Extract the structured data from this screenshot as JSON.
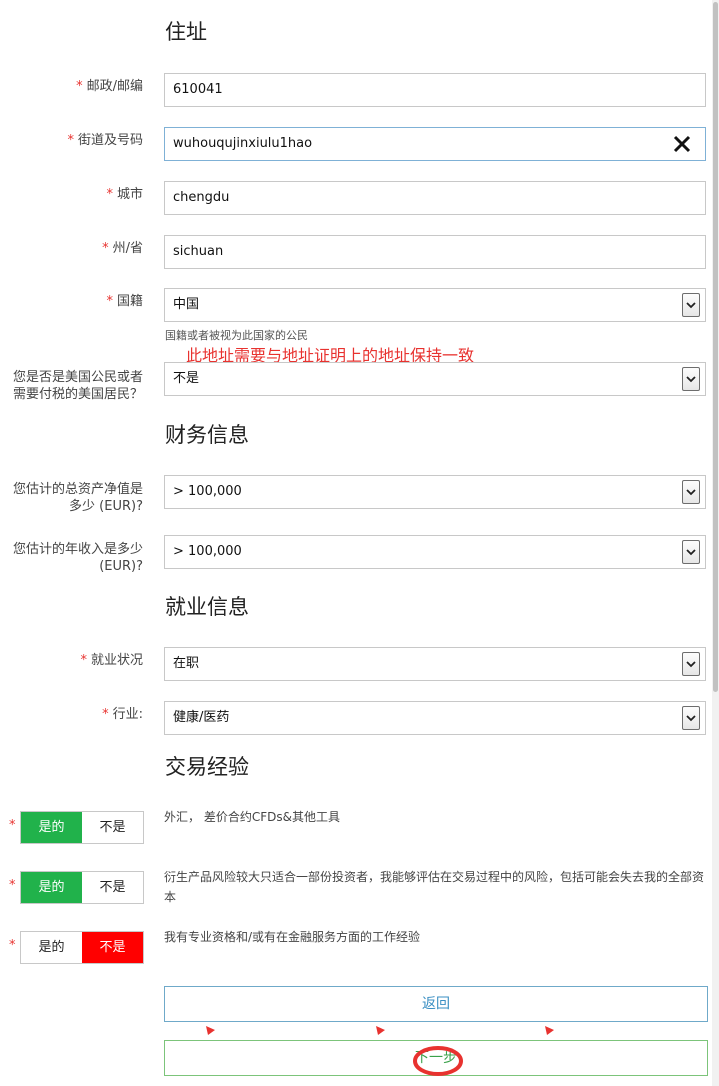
{
  "address": {
    "title": "住址",
    "postal": {
      "label": "邮政/邮编",
      "value": "610041"
    },
    "street": {
      "label": "街道及号码",
      "value": "wuhouqujinxiulu1hao"
    },
    "city": {
      "label": "城市",
      "value": "chengdu"
    },
    "state": {
      "label": "州/省",
      "value": "sichuan"
    },
    "nationality": {
      "label": "国籍",
      "value": "中国",
      "hint": "国籍或者被视为此国家的公民"
    },
    "annotation": "此地址需要与地址证明上的地址保持一致",
    "us_citizen": {
      "label_line1": "您是否是美国公民或者",
      "label_line2": "需要付税的美国居民？",
      "value": "不是"
    }
  },
  "finance": {
    "title": "财务信息",
    "net_worth": {
      "label_line1": "您估计的总资产净值是",
      "label_line2": "多少 (EUR)?",
      "value": "> 100,000"
    },
    "income": {
      "label_line1": "您估计的年收入是多少",
      "label_line2": "(EUR)?",
      "value": "> 100,000"
    }
  },
  "employment": {
    "title": "就业信息",
    "status": {
      "label": "就业状况",
      "value": "在职"
    },
    "industry": {
      "label": "行业:",
      "value": "健康/医药"
    }
  },
  "experience": {
    "title": "交易经验",
    "yes_label": "是的",
    "no_label": "不是",
    "q1": {
      "text": "外汇， 差价合约CFDs&其他工具",
      "selected": "yes"
    },
    "q2": {
      "text": "衍生产品风险较大只适合一部份投资者，我能够评估在交易过程中的风险，包括可能会失去我的全部资本",
      "selected": "yes"
    },
    "q3": {
      "text": "我有专业资格和/或有在金融服务方面的工作经验",
      "selected": "no"
    }
  },
  "buttons": {
    "back": "返回",
    "next": "下一步"
  },
  "colors": {
    "required": "#e8322f",
    "yes_active": "#21b24b",
    "no_active": "#ff0000",
    "annotation": "#e8322f"
  }
}
